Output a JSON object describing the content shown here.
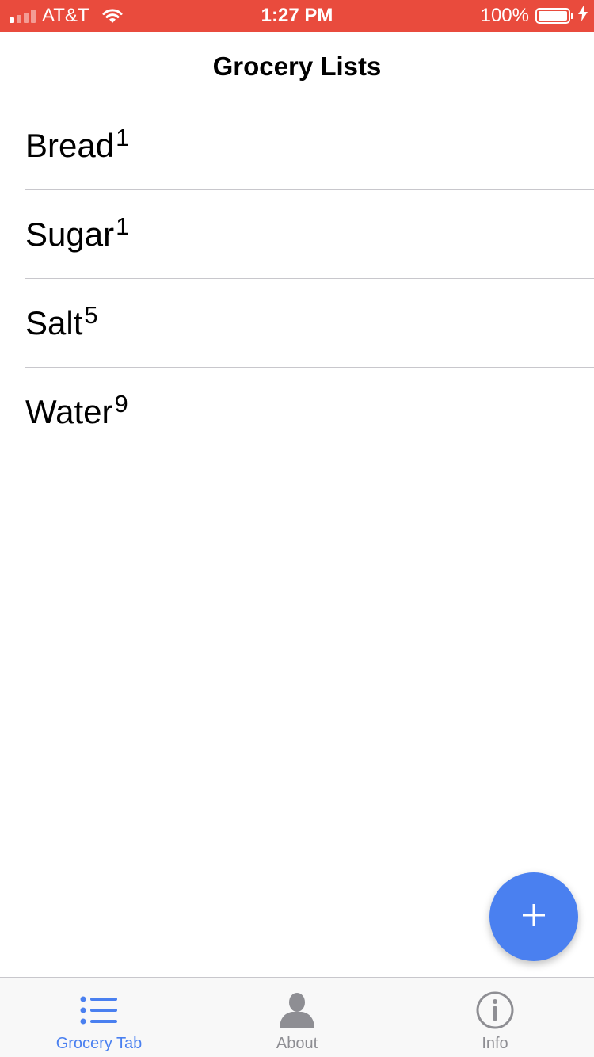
{
  "status_bar": {
    "carrier": "AT&T",
    "time": "1:27 PM",
    "battery_percent": "100%"
  },
  "nav": {
    "title": "Grocery Lists"
  },
  "grocery_items": [
    {
      "name": "Bread",
      "count": "1"
    },
    {
      "name": "Sugar",
      "count": "1"
    },
    {
      "name": "Salt",
      "count": "5"
    },
    {
      "name": "Water",
      "count": "9"
    }
  ],
  "fab": {
    "icon": "plus-icon"
  },
  "tabs": [
    {
      "label": "Grocery Tab",
      "icon": "list-icon",
      "active": true
    },
    {
      "label": "About",
      "icon": "person-icon",
      "active": false
    },
    {
      "label": "Info",
      "icon": "info-icon",
      "active": false
    }
  ],
  "colors": {
    "status_bar": "#e94b3d",
    "accent": "#4a80f0",
    "inactive_tab": "#8e8e93"
  }
}
